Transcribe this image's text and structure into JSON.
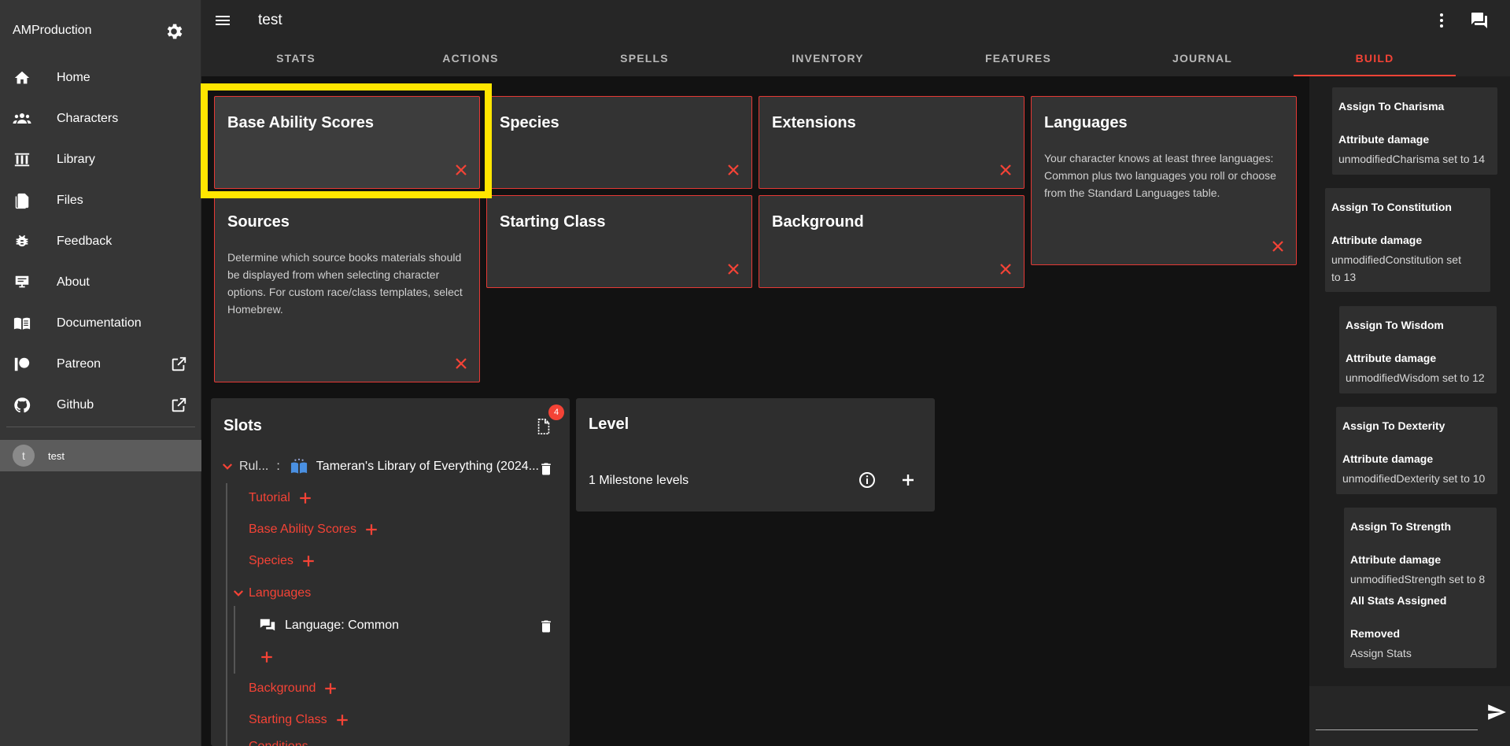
{
  "sidebar": {
    "brand": "AMProduction",
    "items": [
      {
        "label": "Home",
        "icon": "home-icon"
      },
      {
        "label": "Characters",
        "icon": "people-icon"
      },
      {
        "label": "Library",
        "icon": "library-icon"
      },
      {
        "label": "Files",
        "icon": "files-icon"
      },
      {
        "label": "Feedback",
        "icon": "bug-icon"
      },
      {
        "label": "About",
        "icon": "about-icon"
      },
      {
        "label": "Documentation",
        "icon": "book-icon"
      },
      {
        "label": "Patreon",
        "icon": "patreon-icon"
      },
      {
        "label": "Github",
        "icon": "github-icon"
      }
    ],
    "character": {
      "initial": "t",
      "name": "test"
    }
  },
  "topbar": {
    "title": "test"
  },
  "tabs": [
    "STATS",
    "ACTIONS",
    "SPELLS",
    "INVENTORY",
    "FEATURES",
    "JOURNAL",
    "BUILD"
  ],
  "cards": {
    "base_ability": {
      "title": "Base Ability Scores"
    },
    "species": {
      "title": "Species"
    },
    "extensions": {
      "title": "Extensions"
    },
    "languages": {
      "title": "Languages",
      "desc": "Your character knows at least three languages: Common plus two languages you roll or choose from the Standard Languages table."
    },
    "sources": {
      "title": "Sources",
      "desc": "Determine which source books materials should be displayed from when selecting character options. For custom race/class templates, select Homebrew."
    },
    "starting_class": {
      "title": "Starting Class"
    },
    "background": {
      "title": "Background"
    }
  },
  "slots": {
    "title": "Slots",
    "badge": "4",
    "ruleset_label": "Rul...",
    "ruleset_sep": ":",
    "ruleset_value": "Tameran's Library of Everything (2024...",
    "tutorial": "Tutorial",
    "base_ability": "Base Ability Scores",
    "species": "Species",
    "languages": "Languages",
    "language_common": "Language: Common",
    "background": "Background",
    "starting_class": "Starting Class",
    "conditions": "Conditions"
  },
  "level": {
    "title": "Level",
    "value": "1 Milestone levels"
  },
  "log": [
    {
      "title": "Assign To Charisma",
      "action": "Attribute damage",
      "value": "unmodifiedCharisma set to 14"
    },
    {
      "title": "Assign To Constitution",
      "action": "Attribute damage",
      "value": "unmodifiedConstitution set to 13"
    },
    {
      "title": "Assign To Wisdom",
      "action": "Attribute damage",
      "value": "unmodifiedWisdom set to 12"
    },
    {
      "title": "Assign To Dexterity",
      "action": "Attribute damage",
      "value": "unmodifiedDexterity set to 10"
    },
    {
      "title": "Assign To Strength",
      "action": "Attribute damage",
      "value": "unmodifiedStrength set to 8",
      "extra_title": "All Stats Assigned",
      "removed_label": "Removed",
      "removed_value": "Assign Stats"
    }
  ],
  "colors": {
    "accent": "#f44336",
    "highlight": "#ffe600"
  }
}
